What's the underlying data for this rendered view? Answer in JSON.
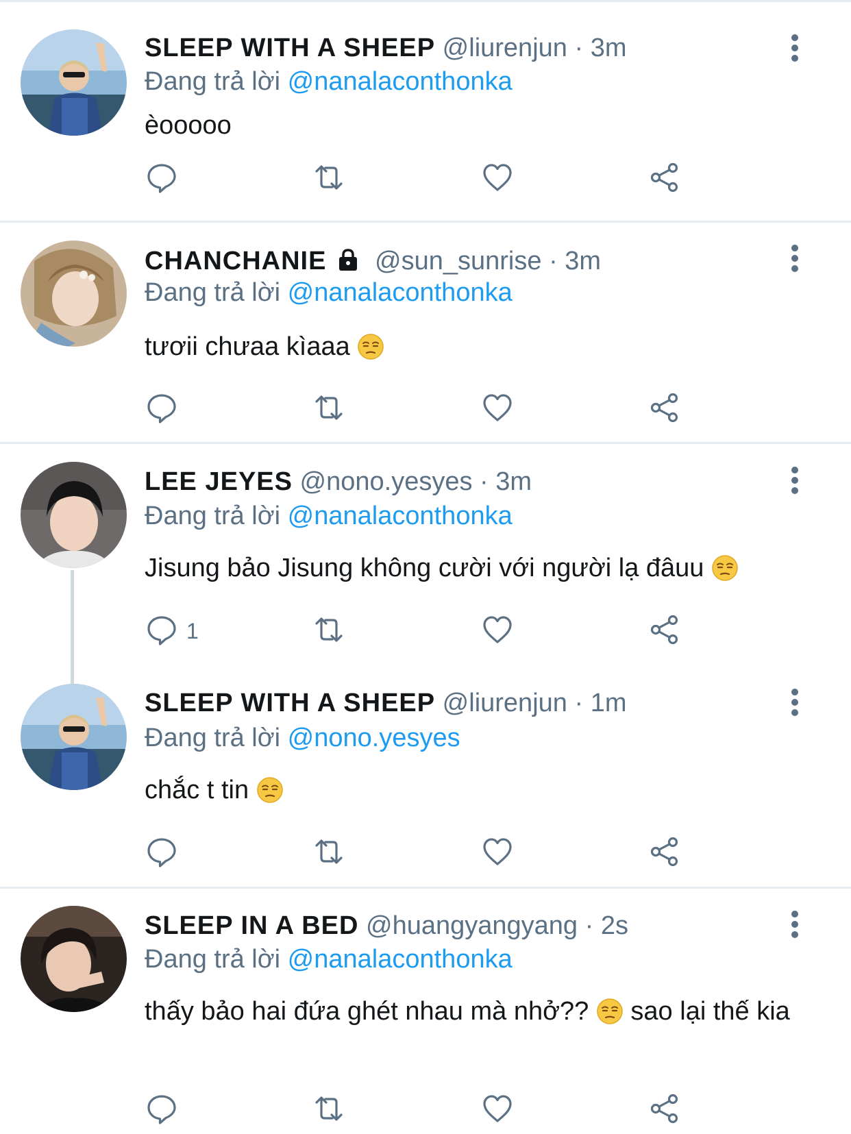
{
  "reply_prefix": "Đang trả lời",
  "tweets": [
    {
      "name": "SLEEP WITH A SHEEP",
      "handle": "@liurenjun",
      "sep": "·",
      "time": "3m",
      "reply_to": "@nanalaconthonka",
      "text_before": "èooooo",
      "text_after": "",
      "reply_count": ""
    },
    {
      "name": "CHANCHANIE",
      "handle": "@sun_sunrise",
      "sep": "·",
      "time": "3m",
      "reply_to": "@nanalaconthonka",
      "text_before": "tươii chưaa kìaaa",
      "text_after": "",
      "reply_count": ""
    },
    {
      "name": "LEE JEYES",
      "handle": "@nono.yesyes",
      "sep": "·",
      "time": "3m",
      "reply_to": "@nanalaconthonka",
      "text_before": "Jisung bảo Jisung không cười với người lạ đâuu",
      "text_after": "",
      "reply_count": "1"
    },
    {
      "name": "SLEEP WITH A SHEEP",
      "handle": "@liurenjun",
      "sep": "·",
      "time": "1m",
      "reply_to": "@nono.yesyes",
      "text_before": "chắc t tin",
      "text_after": "",
      "reply_count": ""
    },
    {
      "name": "SLEEP IN A BED",
      "handle": "@huangyangyang",
      "sep": "·",
      "time": "2s",
      "reply_to": "@nanalaconthonka",
      "text_before": "thấy bảo hai đứa ghét nhau mà nhở??",
      "text_after": "sao lại thế kia",
      "reply_count": ""
    }
  ],
  "icons": {
    "reply": "reply-icon",
    "retweet": "retweet-icon",
    "like": "heart-icon",
    "share": "share-icon",
    "more": "more-vertical-icon",
    "lock": "lock-icon",
    "emoji": "unamused-face-emoji"
  },
  "colors": {
    "mention": "#1d9bf0",
    "secondary": "#5b7083",
    "divider": "#e6ecf0",
    "text": "#14171a"
  }
}
